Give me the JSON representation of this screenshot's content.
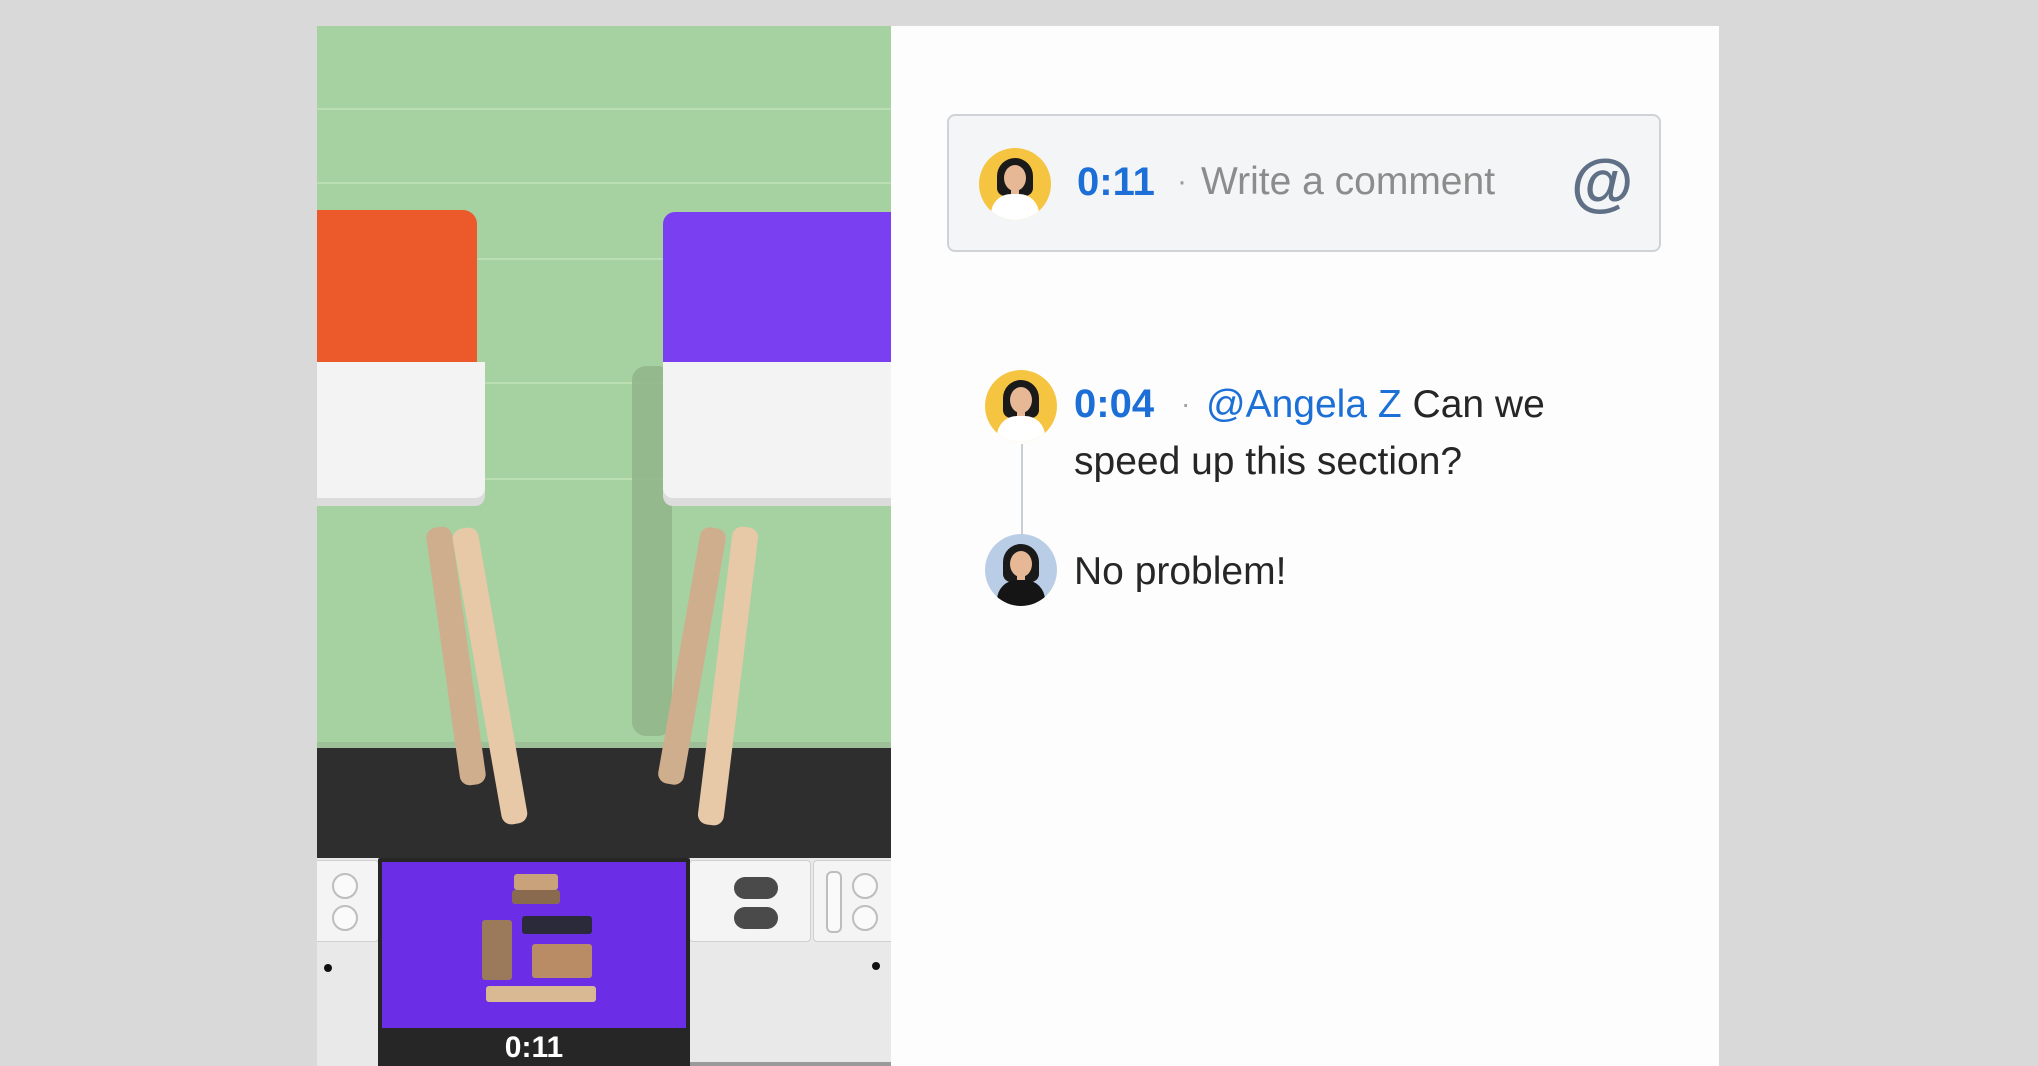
{
  "video": {
    "thumbnail_timestamp": "0:11"
  },
  "comment_input": {
    "timestamp": "0:11",
    "separator": "·",
    "placeholder": "Write a comment",
    "mention_icon": "@"
  },
  "comments": [
    {
      "timestamp": "0:04",
      "separator": "·",
      "mention": "@Angela Z",
      "text": "Can we speed up this section?",
      "avatar": "avatar-woman-yellow-bg"
    },
    {
      "text": "No problem!",
      "avatar": "avatar-woman-blue-bg"
    }
  ],
  "colors": {
    "accent": "#1b6fd6",
    "background": "#d9d9d9",
    "wall": "#a6d1a0",
    "chair_red": "#ec5a2b",
    "chair_purple": "#7a3ff0"
  }
}
